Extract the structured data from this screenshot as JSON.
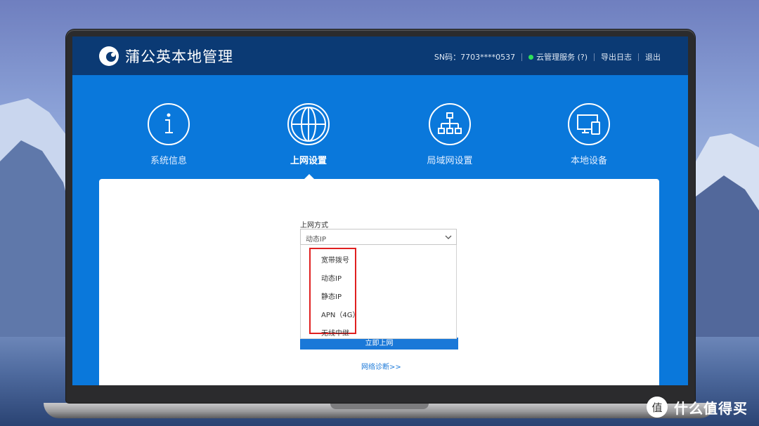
{
  "app": {
    "brand": "蒲公英本地管理",
    "sn": "SN码：7703****0537",
    "cloud_service": "云管理服务 (?)",
    "export_log": "导出日志",
    "logout": "退出",
    "status_color": "#2ee05a"
  },
  "nav": {
    "items": [
      {
        "label": "系统信息",
        "icon": "info-icon"
      },
      {
        "label": "上网设置",
        "icon": "globe-icon",
        "active": true
      },
      {
        "label": "局域网设置",
        "icon": "network-topology-icon"
      },
      {
        "label": "本地设备",
        "icon": "devices-icon"
      }
    ]
  },
  "form": {
    "field_label": "上网方式",
    "selected": "动态IP",
    "options": [
      "宽带拨号",
      "动态IP",
      "静态IP",
      "APN（4G）",
      "无线中继"
    ],
    "submit": "立即上网",
    "diagnose": "网络诊断>>"
  },
  "colors": {
    "header": "#0b3a74",
    "screen_bg": "#0a78db",
    "highlight": "#e02020"
  },
  "watermark": {
    "text": "什么值得买",
    "badge": "值"
  }
}
